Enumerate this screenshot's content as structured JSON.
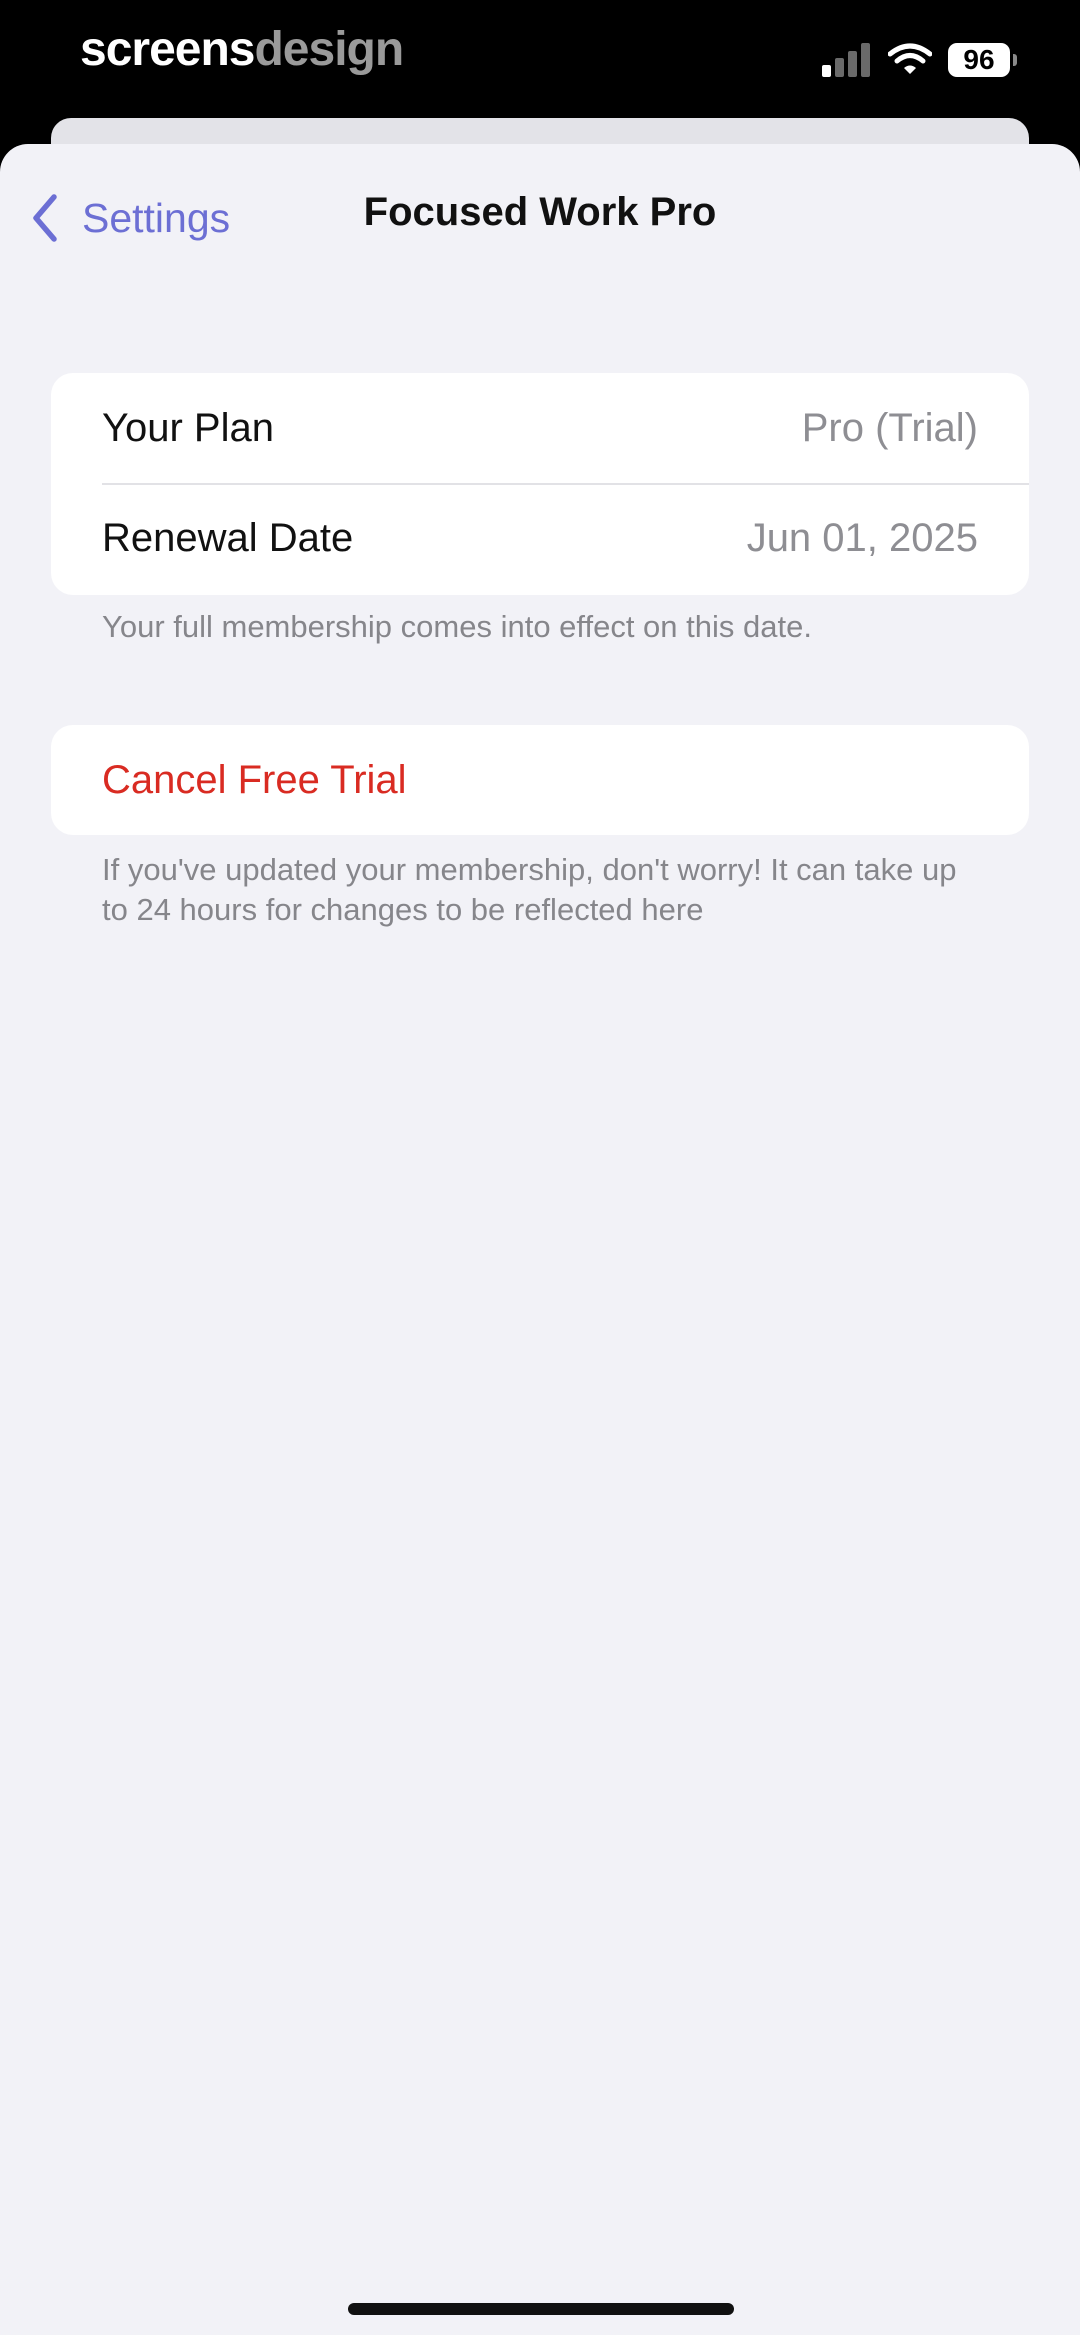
{
  "status_bar": {
    "watermark_part1": "screens",
    "watermark_part2": "design",
    "battery_level": "96",
    "icons": [
      "signal-icon",
      "wifi-icon",
      "battery-icon"
    ]
  },
  "nav": {
    "back_label": "Settings",
    "title": "Focused Work Pro",
    "back_icon": "chevron-left-icon"
  },
  "plan": {
    "rows": [
      {
        "label": "Your Plan",
        "value": "Pro (Trial)"
      },
      {
        "label": "Renewal Date",
        "value": "Jun 01, 2025"
      }
    ],
    "footnote": "Your full membership comes into effect on this date."
  },
  "cancel": {
    "label": "Cancel Free Trial",
    "footnote": "If you've updated your membership, don't worry! It can take up to 24 hours for changes to be reflected here"
  },
  "colors": {
    "accent": "#6c6fd4",
    "destructive": "#d92b22",
    "background": "#f2f2f7",
    "card": "#ffffff",
    "secondary_text": "#8e8e93"
  }
}
